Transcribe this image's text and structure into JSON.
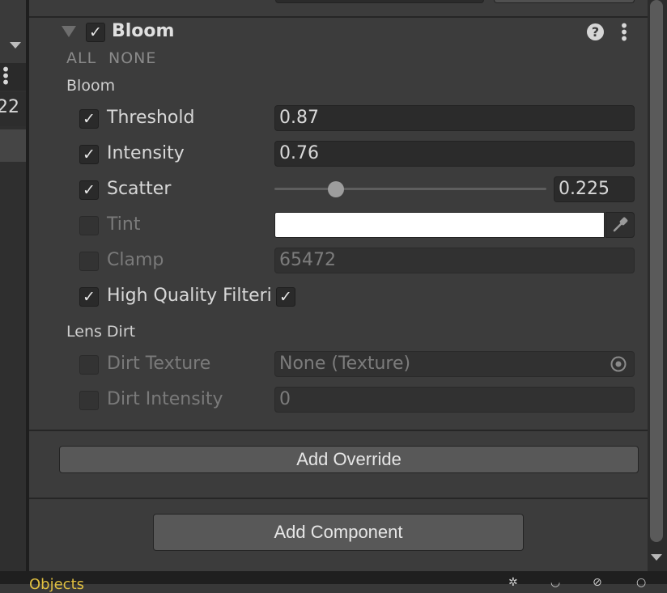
{
  "left_panel": {
    "number_fragment": "22"
  },
  "bloom": {
    "title": "Bloom",
    "all_label": "ALL",
    "none_label": "NONE",
    "section_bloom_label": "Bloom",
    "threshold": {
      "label": "Threshold",
      "value": "0.87",
      "override": true
    },
    "intensity": {
      "label": "Intensity",
      "value": "0.76",
      "override": true
    },
    "scatter": {
      "label": "Scatter",
      "value": "0.225",
      "override": true,
      "slider_fraction": 0.225
    },
    "tint": {
      "label": "Tint",
      "color": "#ffffff",
      "override": false
    },
    "clamp": {
      "label": "Clamp",
      "value": "65472",
      "override": false
    },
    "high_quality": {
      "label": "High Quality Filteri",
      "override": true,
      "checked": true
    },
    "section_lens_dirt_label": "Lens Dirt",
    "dirt_texture": {
      "label": "Dirt Texture",
      "value": "None (Texture)",
      "override": false
    },
    "dirt_intensity": {
      "label": "Dirt Intensity",
      "value": "0",
      "override": false
    }
  },
  "buttons": {
    "add_override": "Add Override",
    "add_component": "Add Component"
  },
  "bottom": {
    "text_fragment": "Objects"
  },
  "icons": {
    "foldout": "triangle-down-icon",
    "help": "help-icon",
    "menu": "kebab-menu-icon",
    "eyedropper": "eyedropper-icon",
    "object_picker": "object-picker-icon"
  }
}
